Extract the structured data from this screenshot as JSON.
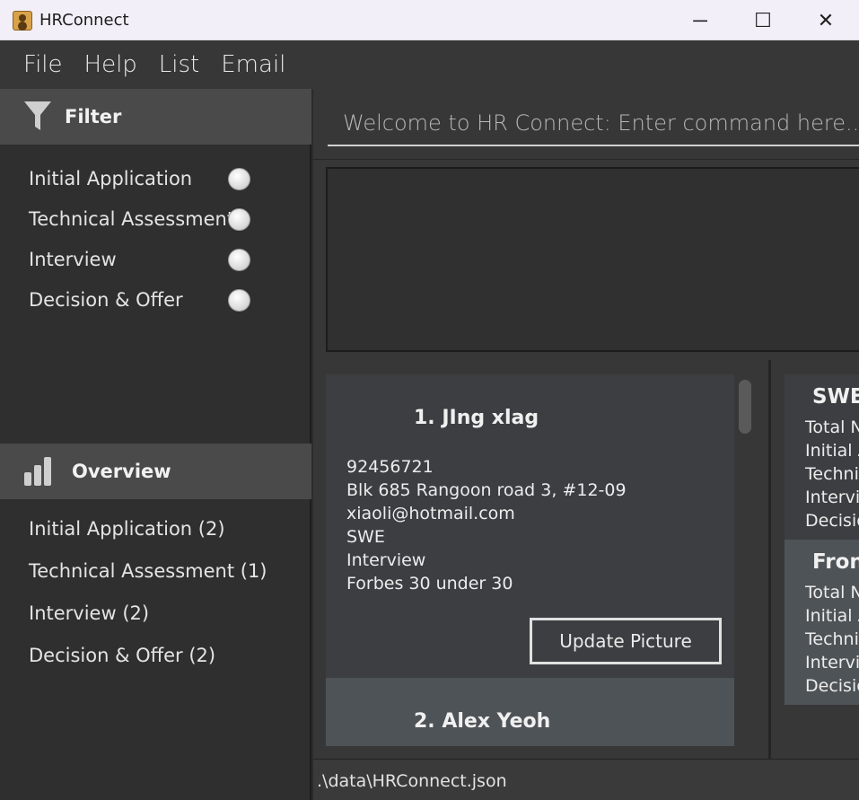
{
  "window": {
    "title": "HRConnect",
    "icon": "contact-card-icon",
    "controls": {
      "minimize": "─",
      "maximize": "☐",
      "close": "✕"
    }
  },
  "menu": {
    "items": [
      "File",
      "Help",
      "List",
      "Email"
    ]
  },
  "sidebar": {
    "filter": {
      "title": "Filter",
      "icon": "funnel-icon",
      "options": [
        "Initial Application",
        "Technical Assessment",
        "Interview",
        "Decision & Offer"
      ]
    },
    "overview": {
      "title": "Overview",
      "icon": "bar-chart-icon",
      "items": [
        "Initial Application (2)",
        "Technical Assessment (1)",
        "Interview (2)",
        "Decision & Offer (2)"
      ]
    }
  },
  "command": {
    "placeholder": "Welcome to HR Connect: Enter command here..."
  },
  "applicants": [
    {
      "name": "1.  JIng xlag",
      "fields": [
        "92456721",
        "Blk 685 Rangoon road 3, #12-09",
        "xiaoli@hotmail.com",
        "SWE",
        "Interview",
        "Forbes 30 under 30"
      ],
      "button": "Update Picture"
    },
    {
      "name": "2.  Alex Yeoh"
    }
  ],
  "stats": [
    {
      "title": "SWE",
      "lines": [
        "Total N",
        "Initial A",
        "Techni",
        "Intervie",
        "Decisio"
      ]
    },
    {
      "title": "Fron",
      "lines": [
        "Total N",
        "Initial A",
        "Techni",
        "Intervie",
        "Decisio"
      ]
    }
  ],
  "status": {
    "path": ".\\data\\HRConnect.json"
  },
  "colors": {
    "background": "#2b2b2b",
    "titlebar": "#f3eff8",
    "section_header": "#4a4a4a",
    "card": "#3c3e41",
    "card_alt": "#4e5357"
  }
}
